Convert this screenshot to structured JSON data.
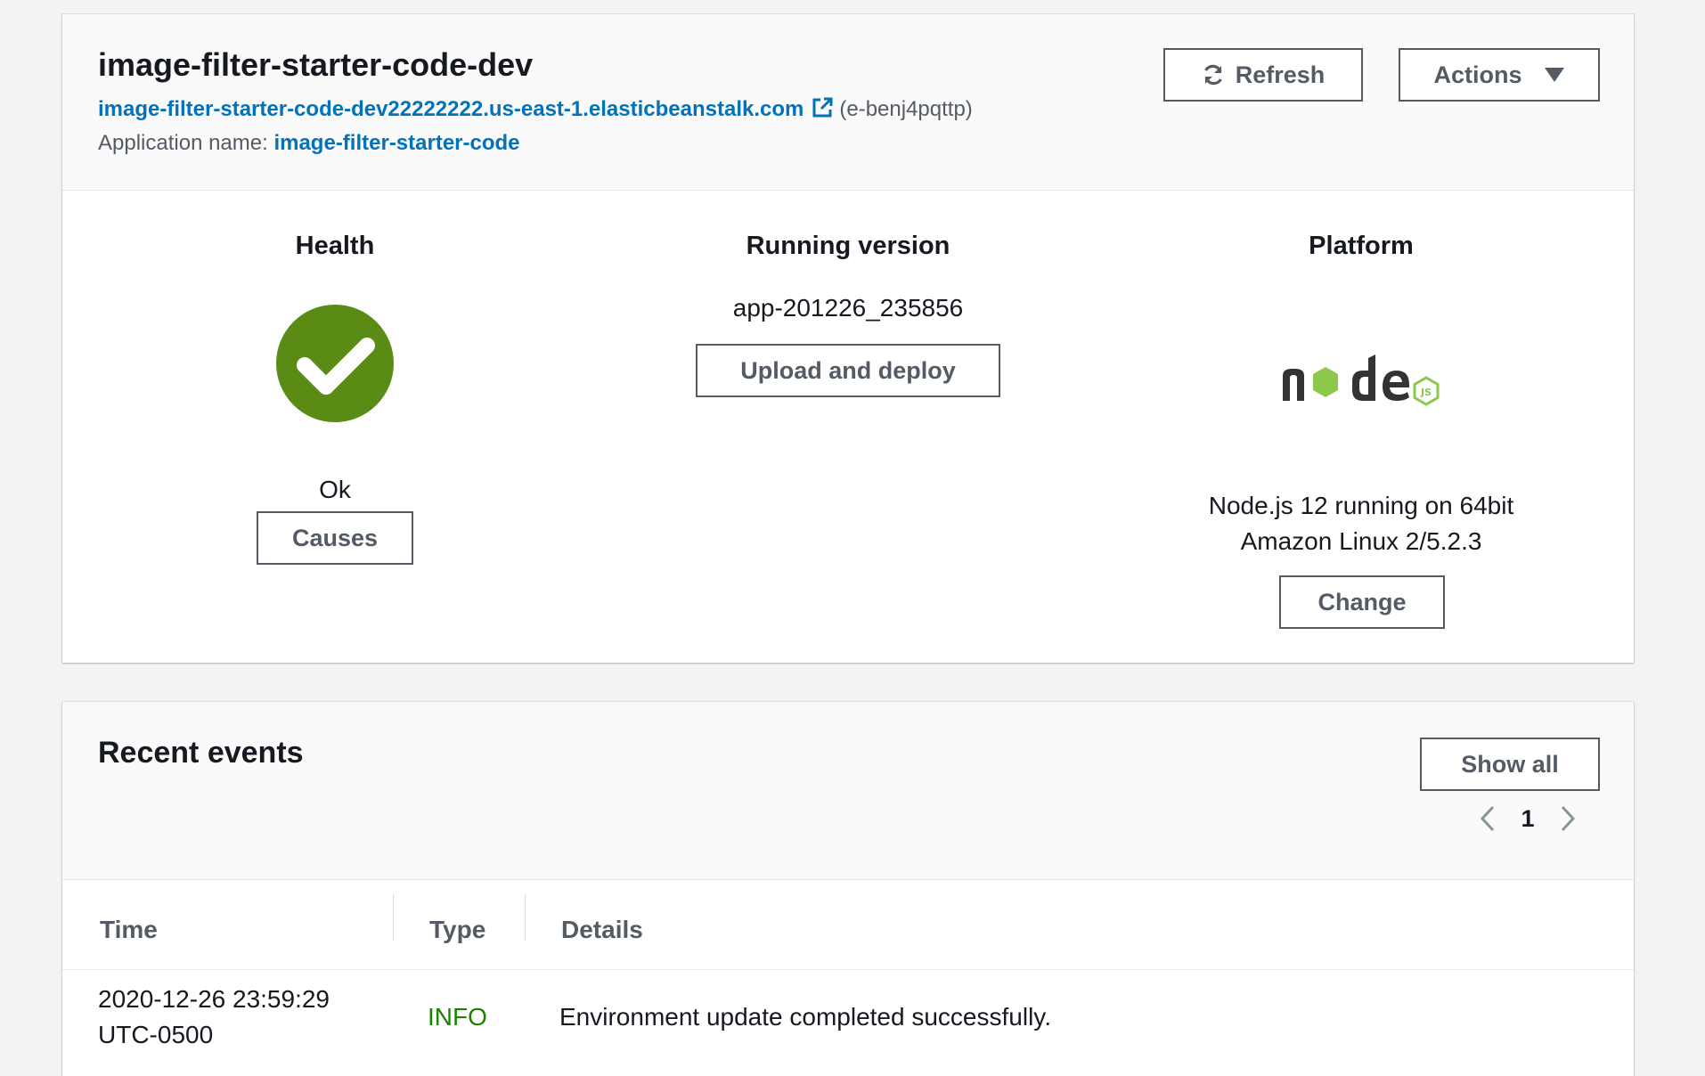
{
  "environment": {
    "title": "image-filter-starter-code-dev",
    "url": "image-filter-starter-code-dev22222222.us-east-1.elasticbeanstalk.com",
    "env_id": "(e-benj4pqttp)",
    "app_name_label": "Application name:",
    "app_name": "image-filter-starter-code"
  },
  "toolbar": {
    "refresh_label": "Refresh",
    "actions_label": "Actions"
  },
  "health": {
    "title": "Health",
    "status": "Ok",
    "causes_label": "Causes",
    "color": "#5a8b14"
  },
  "running_version": {
    "title": "Running version",
    "version": "app-201226_235856",
    "upload_label": "Upload and deploy"
  },
  "platform": {
    "title": "Platform",
    "description_line1": "Node.js 12 running on 64bit",
    "description_line2": "Amazon Linux 2/5.2.3",
    "change_label": "Change",
    "logo_icon": "nodejs-logo-icon"
  },
  "events": {
    "title": "Recent events",
    "show_all_label": "Show all",
    "current_page": "1",
    "columns": [
      "Time",
      "Type",
      "Details"
    ],
    "rows": [
      {
        "time_line1": "2020-12-26 23:59:29",
        "time_line2": "UTC-0500",
        "type": "INFO",
        "details": "Environment update completed successfully."
      }
    ]
  },
  "colors": {
    "link": "#0073bb",
    "info": "#1d8102",
    "node_green": "#8cc84b",
    "node_dark": "#333333"
  }
}
